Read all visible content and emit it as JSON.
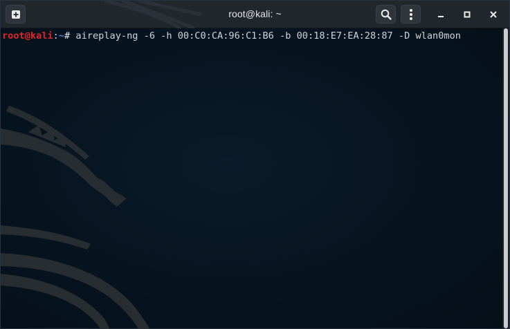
{
  "window": {
    "title": "root@kali: ~"
  },
  "toolbar": {
    "new_tab_icon": "new-tab-icon",
    "search_icon": "search-icon",
    "menu_icon": "kebab-menu-icon",
    "minimize_icon": "minimize-icon",
    "maximize_icon": "maximize-icon",
    "close_icon": "close-icon"
  },
  "terminal": {
    "prompt_user": "root@kali",
    "prompt_colon": ":",
    "prompt_path": "~",
    "prompt_symbol": "# ",
    "command": "aireplay-ng -6 -h 00:C0:CA:96:C1:B6 -b 00:18:E7:EA:28:87 -D wlan0mon"
  },
  "colors": {
    "prompt_user": "#e0242b",
    "prompt_path": "#5a7fd6",
    "background": "#06131f",
    "titlebar": "#22262d"
  }
}
